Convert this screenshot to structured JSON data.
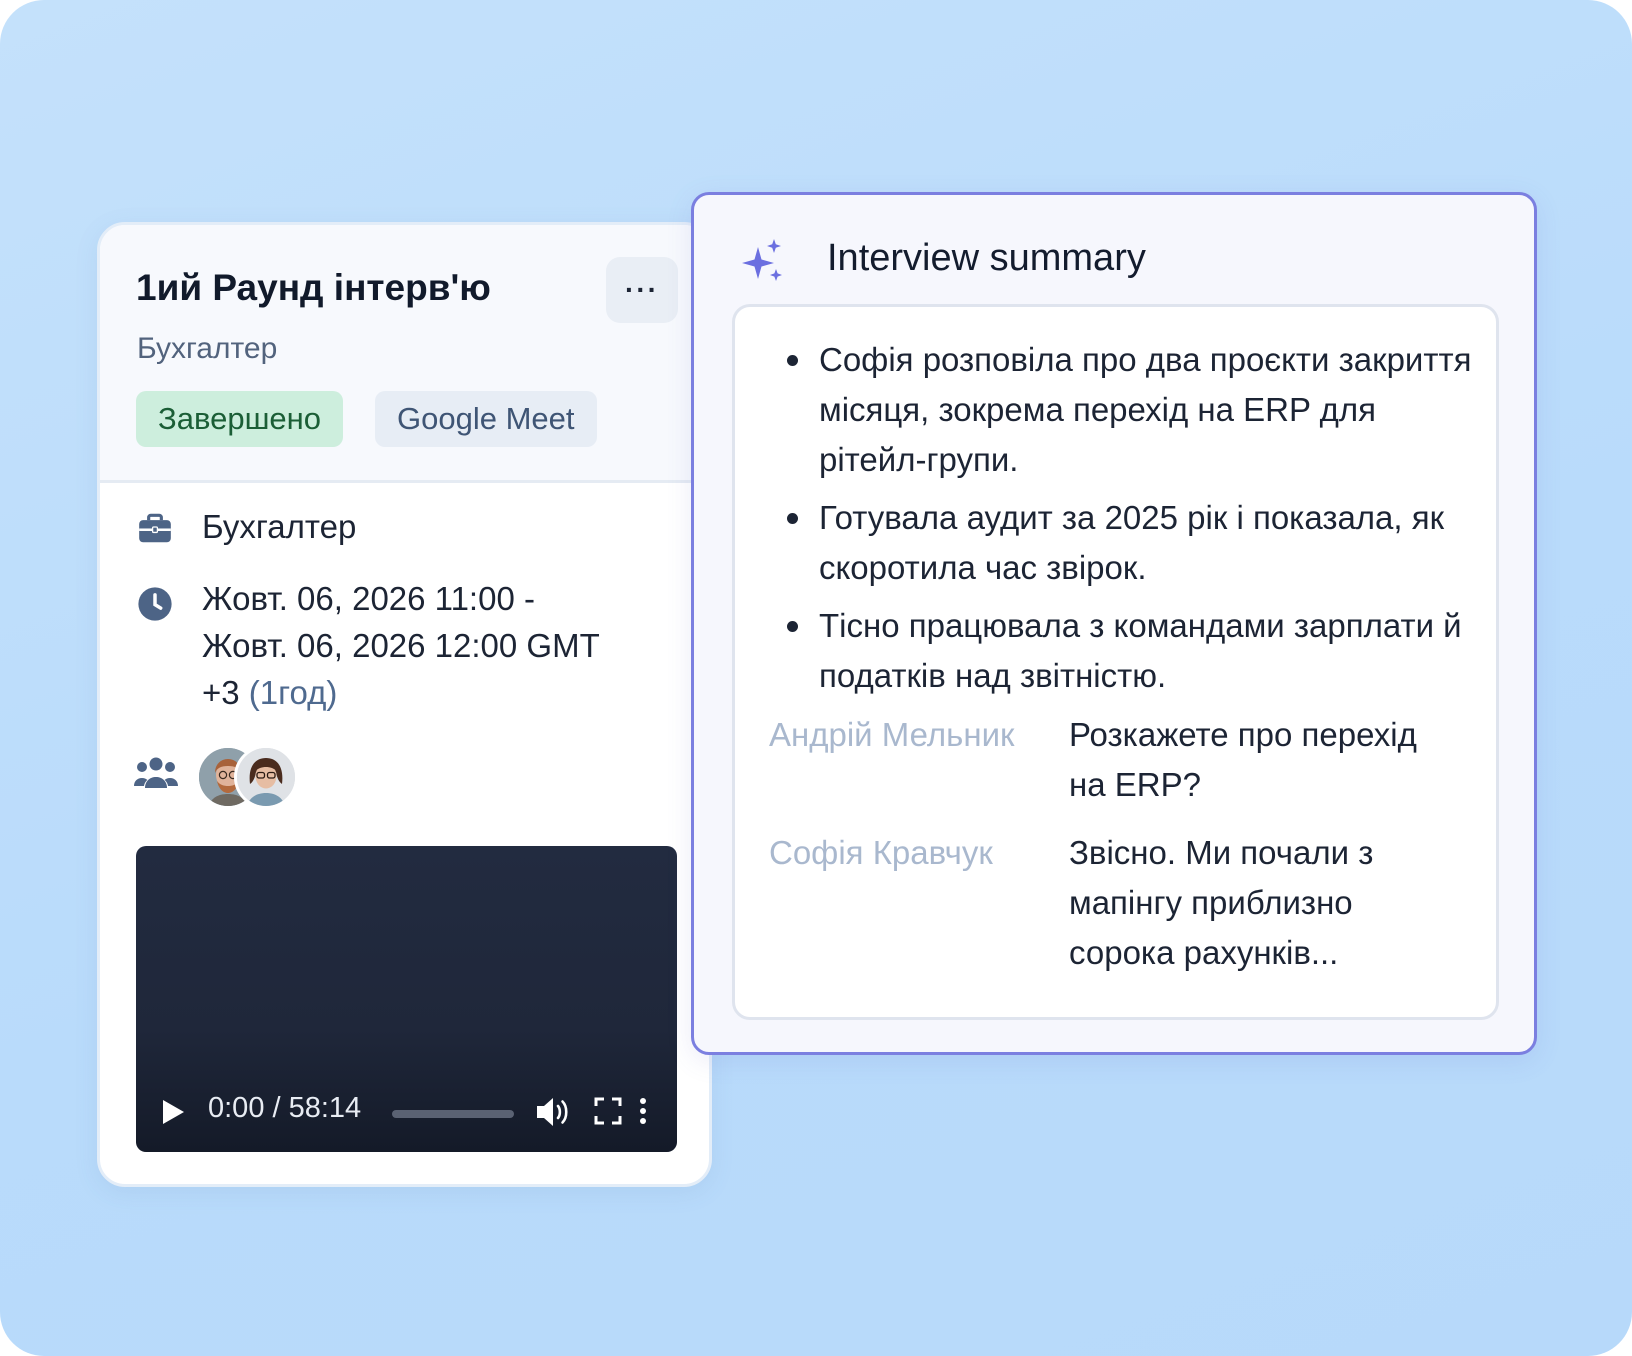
{
  "interview": {
    "title": "1ий Раунд інтерв'ю",
    "subtitle": "Бухгалтер",
    "more_label": "···",
    "status_tag": "Завершено",
    "platform_tag": "Google Meet",
    "position": "Бухгалтер",
    "time_line1": "Жовт. 06, 2026 11:00 -",
    "time_line2": "Жовт. 06, 2026 12:00 GMT",
    "time_line3": "+3",
    "duration": "(1год)",
    "participants_icon": "users-icon",
    "participants": [
      {
        "name": "participant-1",
        "avatar": "bearded man with glasses"
      },
      {
        "name": "participant-2",
        "avatar": "woman with glasses"
      }
    ]
  },
  "video": {
    "time": "0:00 / 58:14",
    "progress": 0.0
  },
  "summary": {
    "title": "Interview summary",
    "icon": "sparkle-icon",
    "bullets": [
      "Софія розповіла про два проєкти закриття місяця, зокрема перехід на ERP для рітейл-групи.",
      "Готувала аудит за 2025 рік і показала, як скоротила час звірок.",
      "Тісно працювала з командами зарплати й податків над звітністю."
    ],
    "transcript": [
      {
        "speaker": "Андрій Мельник",
        "text": "Розкажете про перехід на ERP?"
      },
      {
        "speaker": "Софія Кравчук",
        "text": "Звісно. Ми почали з мапінгу приблизно сорока рахунків..."
      }
    ]
  },
  "colors": {
    "background": "#bcdcfa",
    "accent": "#7b7fe0",
    "status_green_bg": "#cdeedd",
    "status_green_text": "#1b5e36",
    "muted_speaker": "#a9b8ce"
  }
}
